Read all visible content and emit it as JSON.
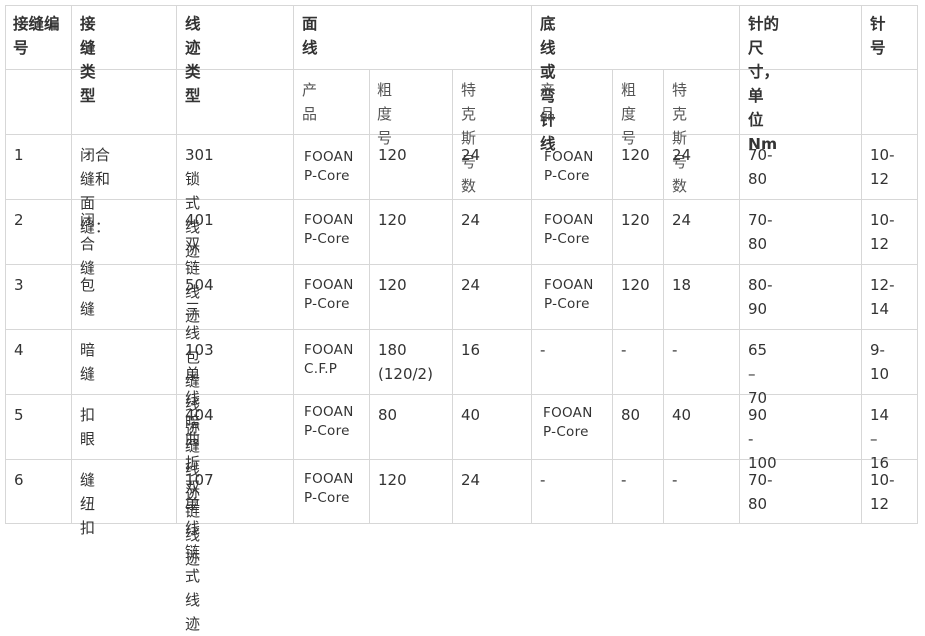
{
  "header": {
    "seam_no": "接缝编\n号",
    "seam_type": "接缝类型",
    "stitch_type": "线迹类型",
    "needle_thread": "面线",
    "looper_thread": "底线或弯针线",
    "needle_size": "针的尺寸，单\n位Nm",
    "needle_no": "针号"
  },
  "subheader": {
    "nt_product": "产品",
    "nt_ticket": "粗度号",
    "nt_tex": "特克斯\n号数",
    "lt_product": "产品",
    "lt_ticket": "粗度\n号",
    "lt_tex": "特克斯\n号数"
  },
  "rows": [
    {
      "no": "1",
      "seam": "闭合缝和面\n缝：",
      "stitch": "301 锁式线迹",
      "nt_product": "FOOAN\nP-Core",
      "nt_ticket": "120",
      "nt_tex": "24",
      "lt_product": "FOOAN\nP-Core",
      "lt_ticket": "120",
      "lt_tex": "24",
      "size": "70-80",
      "needle": "10-\n12"
    },
    {
      "no": "2",
      "seam": "闭合缝",
      "stitch": "401 双链线迹",
      "nt_product": "FOOAN\nP-Core",
      "nt_ticket": "120",
      "nt_tex": "24",
      "lt_product": "FOOAN\nP-Core",
      "lt_ticket": "120",
      "lt_tex": "24",
      "size": "70-80",
      "needle": "10-\n12"
    },
    {
      "no": "3",
      "seam": "包缝",
      "stitch": "504 三线包缝\n线迹",
      "nt_product": "FOOAN\nP-Core",
      "nt_ticket": "120",
      "nt_tex": "24",
      "lt_product": "FOOAN\nP-Core",
      "lt_ticket": "120",
      "lt_tex": "18",
      "size": "80-90",
      "needle": "12-\n14"
    },
    {
      "no": "4",
      "seam": "暗缝",
      "stitch": "103 单线暗缝\n线迹",
      "nt_product": "FOOAN\nC.F.P",
      "nt_ticket": "180\n(120/2)",
      "nt_tex": "16",
      "lt_product": "-",
      "lt_ticket": "-",
      "lt_tex": "-",
      "size": "65 – 70",
      "needle": "9-10"
    },
    {
      "no": "5",
      "seam": "扣眼",
      "stitch": "404 曲折双链\n线迹",
      "nt_product": "FOOAN\nP-Core",
      "nt_ticket": "80",
      "nt_tex": "40",
      "lt_product": "FOOAN\nP-Core",
      "lt_ticket": "80",
      "lt_tex": "40",
      "size": "90 - 100",
      "needle": "14 –\n16"
    },
    {
      "no": "6",
      "seam": "缝纽扣",
      "stitch": "107 单线链式\n线迹",
      "nt_product": "FOOAN\nP-Core",
      "nt_ticket": "120",
      "nt_tex": "24",
      "lt_product": "-",
      "lt_ticket": "-",
      "lt_tex": "-",
      "size": "70-80",
      "needle": "10-\n12"
    }
  ],
  "colors": {
    "grid": "#d7d7d7",
    "text": "#333333"
  }
}
